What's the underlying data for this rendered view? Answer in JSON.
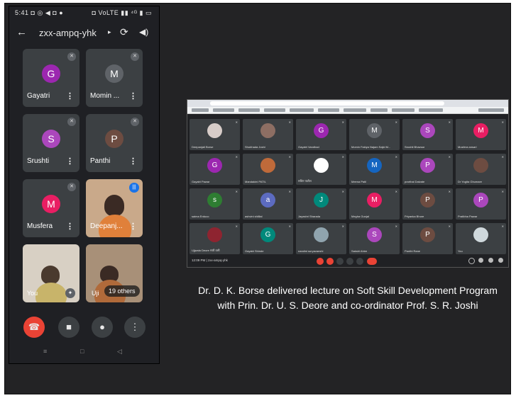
{
  "phone": {
    "status_time": "5:41",
    "status_left_icons": "◘ ◎ ◀ ◘ ●",
    "status_right": "◘ VoLTE ▮▮ ⁴ᴳ ▮ ▭",
    "meeting_code": "zxx-ampq-yhk",
    "caret": "▸",
    "back_icon": "←",
    "flip_icon": "⟳",
    "speaker_icon": "🔊",
    "tiles": [
      {
        "initial": "G",
        "name": "Gayatri",
        "color": "#9c27b0"
      },
      {
        "initial": "M",
        "name": "Momin ...",
        "color": "#5f6368"
      },
      {
        "initial": "S",
        "name": "Srushti",
        "color": "#ab47bc"
      },
      {
        "initial": "P",
        "name": "Panthi",
        "color": "#6d4c41"
      },
      {
        "initial": "M",
        "name": "Musfera",
        "color": "#e91e63"
      },
      {
        "name": "Deepanj..."
      },
      {
        "name": "You"
      },
      {
        "name": "Uji",
        "others": "19 others"
      }
    ],
    "dots": "⋮",
    "muted_icon": "✕",
    "controls": {
      "end": "☎",
      "camera": "■",
      "mic": "●",
      "more": "⋮"
    },
    "navbar": {
      "menu": "≡",
      "home": "□",
      "back": "◁"
    }
  },
  "laptop": {
    "time_label": "12:09 PM | zxx-ampq-yhk",
    "tiles": [
      {
        "name": "Deepanjali Borse",
        "initial": "",
        "color": "#d7ccc8",
        "photo": true
      },
      {
        "name": "Shubhada Joshi",
        "initial": "",
        "color": "#8d6e63",
        "photo": true
      },
      {
        "name": "Gayatri Vandhad",
        "initial": "G",
        "color": "#9c27b0"
      },
      {
        "name": "Momin Fakiya Najam Sajid M...",
        "initial": "M",
        "color": "#5f6368"
      },
      {
        "name": "Srushti Bhavsar",
        "initial": "S",
        "color": "#ab47bc"
      },
      {
        "name": "Musfera ansari",
        "initial": "M",
        "color": "#e91e63"
      },
      {
        "name": "Gayatri Pawar",
        "initial": "G",
        "color": "#9c27b0"
      },
      {
        "name": "Mandakini PATIL",
        "initial": "",
        "color": "#bf6a3a",
        "photo": true
      },
      {
        "name": "सचिन पाटील",
        "initial": "",
        "color": "#ffffff",
        "photo": true
      },
      {
        "name": "Meena Patil",
        "initial": "M",
        "color": "#1565c0"
      },
      {
        "name": "prarthai Dalvate",
        "initial": "P",
        "color": "#ab47bc"
      },
      {
        "name": "Dr Yogita Ghumare",
        "initial": "",
        "color": "#6d4c41",
        "photo": true
      },
      {
        "name": "saima Erduco",
        "initial": "s",
        "color": "#2e7d32"
      },
      {
        "name": "ashvini shillial",
        "initial": "a",
        "color": "#5c6bc0"
      },
      {
        "name": "Jayashri Sharada",
        "initial": "J",
        "color": "#00897b"
      },
      {
        "name": "Megha Gunjal",
        "initial": "M",
        "color": "#e91e63"
      },
      {
        "name": "Priyanka Bhore",
        "initial": "P",
        "color": "#6d4c41"
      },
      {
        "name": "Pratibha Pawar",
        "initial": "P",
        "color": "#ab47bc"
      },
      {
        "name": "Ujjwala Deore सारी वली",
        "initial": "",
        "color": "#8e2430",
        "photo": true
      },
      {
        "name": "Gayatri Shinde",
        "initial": "G",
        "color": "#00897b"
      },
      {
        "name": "nandini suryavanshi",
        "initial": "",
        "color": "#90a4ae",
        "photo": true
      },
      {
        "name": "Sakshi Ahire",
        "initial": "S",
        "color": "#ab47bc"
      },
      {
        "name": "Panthi Rane",
        "initial": "P",
        "color": "#6d4c41"
      },
      {
        "name": "You",
        "initial": "",
        "color": "#cfd8dc",
        "photo": true
      }
    ]
  },
  "caption": "Dr. D. K. Borse delivered lecture on Soft Skill Development Program with Prin. Dr. U. S. Deore and co-ordinator Prof. S. R. Joshi"
}
